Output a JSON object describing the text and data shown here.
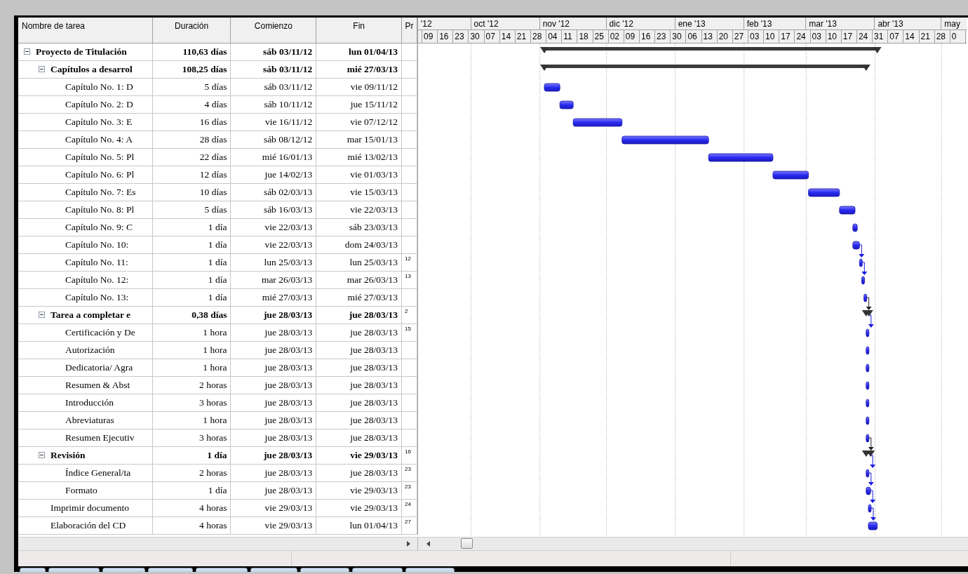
{
  "columns": [
    "Nombre de tarea",
    "Duración",
    "Comienzo",
    "Fin",
    "Pr"
  ],
  "timescale": {
    "months": [
      "'12",
      "oct '12",
      "nov '12",
      "dic '12",
      "ene '13",
      "feb '13",
      "mar '13",
      "abr '13",
      "may"
    ],
    "weeks": [
      "09",
      "16",
      "23",
      "30",
      "07",
      "14",
      "21",
      "28",
      "04",
      "11",
      "18",
      "25",
      "02",
      "09",
      "16",
      "23",
      "30",
      "06",
      "13",
      "20",
      "27",
      "03",
      "10",
      "17",
      "24",
      "03",
      "10",
      "17",
      "24",
      "31",
      "07",
      "14",
      "21",
      "28",
      "0"
    ]
  },
  "tasks": [
    {
      "kind": "summary",
      "name": "Proyecto de Titulación",
      "duration": "110,63 días",
      "start": "sáb 03/11/12",
      "finish": "lun 01/04/13",
      "expanded": true,
      "children": [
        {
          "kind": "summary",
          "name": "Capítulos a desarrol",
          "duration": "108,25 días",
          "start": "sáb 03/11/12",
          "finish": "mié 27/03/13",
          "expanded": true,
          "children": [
            {
              "kind": "task",
              "name": "Capítulo No. 1: D",
              "duration": "5 días",
              "start": "sáb 03/11/12",
              "finish": "vie 09/11/12"
            },
            {
              "kind": "task",
              "name": "Capítulo No. 2: D",
              "duration": "4 días",
              "start": "sáb 10/11/12",
              "finish": "jue 15/11/12"
            },
            {
              "kind": "task",
              "name": "Capítulo No. 3: E",
              "duration": "16 días",
              "start": "vie 16/11/12",
              "finish": "vie 07/12/12"
            },
            {
              "kind": "task",
              "name": "Capítulo No. 4: A",
              "duration": "28 días",
              "start": "sáb 08/12/12",
              "finish": "mar 15/01/13"
            },
            {
              "kind": "task",
              "name": "Capítulo No. 5: Pl",
              "duration": "22 días",
              "start": "mié 16/01/13",
              "finish": "mié 13/02/13"
            },
            {
              "kind": "task",
              "name": "Capítulo No. 6: Pl",
              "duration": "12 días",
              "start": "jue 14/02/13",
              "finish": "vie 01/03/13"
            },
            {
              "kind": "task",
              "name": "Capítulo No. 7: Es",
              "duration": "10 días",
              "start": "sáb 02/03/13",
              "finish": "vie 15/03/13"
            },
            {
              "kind": "task",
              "name": "Capítulo No. 8: Pl",
              "duration": "5 días",
              "start": "sáb 16/03/13",
              "finish": "vie 22/03/13"
            },
            {
              "kind": "task",
              "name": "Capítulo No. 9: C",
              "duration": "1 día",
              "start": "vie 22/03/13",
              "finish": "sáb 23/03/13"
            },
            {
              "kind": "task",
              "name": "Capítulo No. 10:",
              "duration": "1 día",
              "start": "vie 22/03/13",
              "finish": "dom 24/03/13"
            },
            {
              "kind": "task",
              "name": "Capítulo No. 11:",
              "duration": "1 día",
              "start": "lun 25/03/13",
              "finish": "lun 25/03/13",
              "predecessors": "12"
            },
            {
              "kind": "task",
              "name": "Capítulo No. 12:",
              "duration": "1 día",
              "start": "mar 26/03/13",
              "finish": "mar 26/03/13",
              "predecessors": "13"
            },
            {
              "kind": "task",
              "name": "Capítulo No. 13:",
              "duration": "1 día",
              "start": "mié 27/03/13",
              "finish": "mié 27/03/13"
            }
          ]
        },
        {
          "kind": "summary",
          "name": "Tarea a completar e",
          "duration": "0,38 días",
          "start": "jue 28/03/13",
          "finish": "jue 28/03/13",
          "predecessors": "2",
          "expanded": true,
          "children": [
            {
              "kind": "task",
              "name": "Certificación y De",
              "duration": "1 hora",
              "start": "jue 28/03/13",
              "finish": "jue 28/03/13",
              "predecessors": "15"
            },
            {
              "kind": "task",
              "name": "Autorización",
              "duration": "1 hora",
              "start": "jue 28/03/13",
              "finish": "jue 28/03/13"
            },
            {
              "kind": "task",
              "name": "Dedicatoria/ Agra",
              "duration": "1 hora",
              "start": "jue 28/03/13",
              "finish": "jue 28/03/13"
            },
            {
              "kind": "task",
              "name": "Resumen & Abst",
              "duration": "2 horas",
              "start": "jue 28/03/13",
              "finish": "jue 28/03/13"
            },
            {
              "kind": "task",
              "name": "Introducción",
              "duration": "3 horas",
              "start": "jue 28/03/13",
              "finish": "jue 28/03/13"
            },
            {
              "kind": "task",
              "name": "Abreviaturas",
              "duration": "1 hora",
              "start": "jue 28/03/13",
              "finish": "jue 28/03/13"
            },
            {
              "kind": "task",
              "name": "Resumen Ejecutiv",
              "duration": "3 horas",
              "start": "jue 28/03/13",
              "finish": "jue 28/03/13"
            }
          ]
        },
        {
          "kind": "summary",
          "name": "Revisión",
          "duration": "1 día",
          "start": "jue 28/03/13",
          "finish": "vie 29/03/13",
          "predecessors": "16",
          "expanded": true,
          "children": [
            {
              "kind": "task",
              "name": "Índice General/ta",
              "duration": "2 horas",
              "start": "jue 28/03/13",
              "finish": "jue 28/03/13",
              "predecessors": "23"
            },
            {
              "kind": "task",
              "name": "Formato",
              "duration": "1 día",
              "start": "jue 28/03/13",
              "finish": "vie 29/03/13",
              "predecessors": "23"
            }
          ]
        },
        {
          "kind": "task",
          "name": "Imprimir documento",
          "duration": "4 horas",
          "start": "vie 29/03/13",
          "finish": "vie 29/03/13",
          "predecessors": "24"
        },
        {
          "kind": "task",
          "name": "Elaboración del CD",
          "duration": "4 horas",
          "start": "vie 29/03/13",
          "finish": "lun 01/04/13",
          "predecessors": "27"
        }
      ]
    }
  ]
}
